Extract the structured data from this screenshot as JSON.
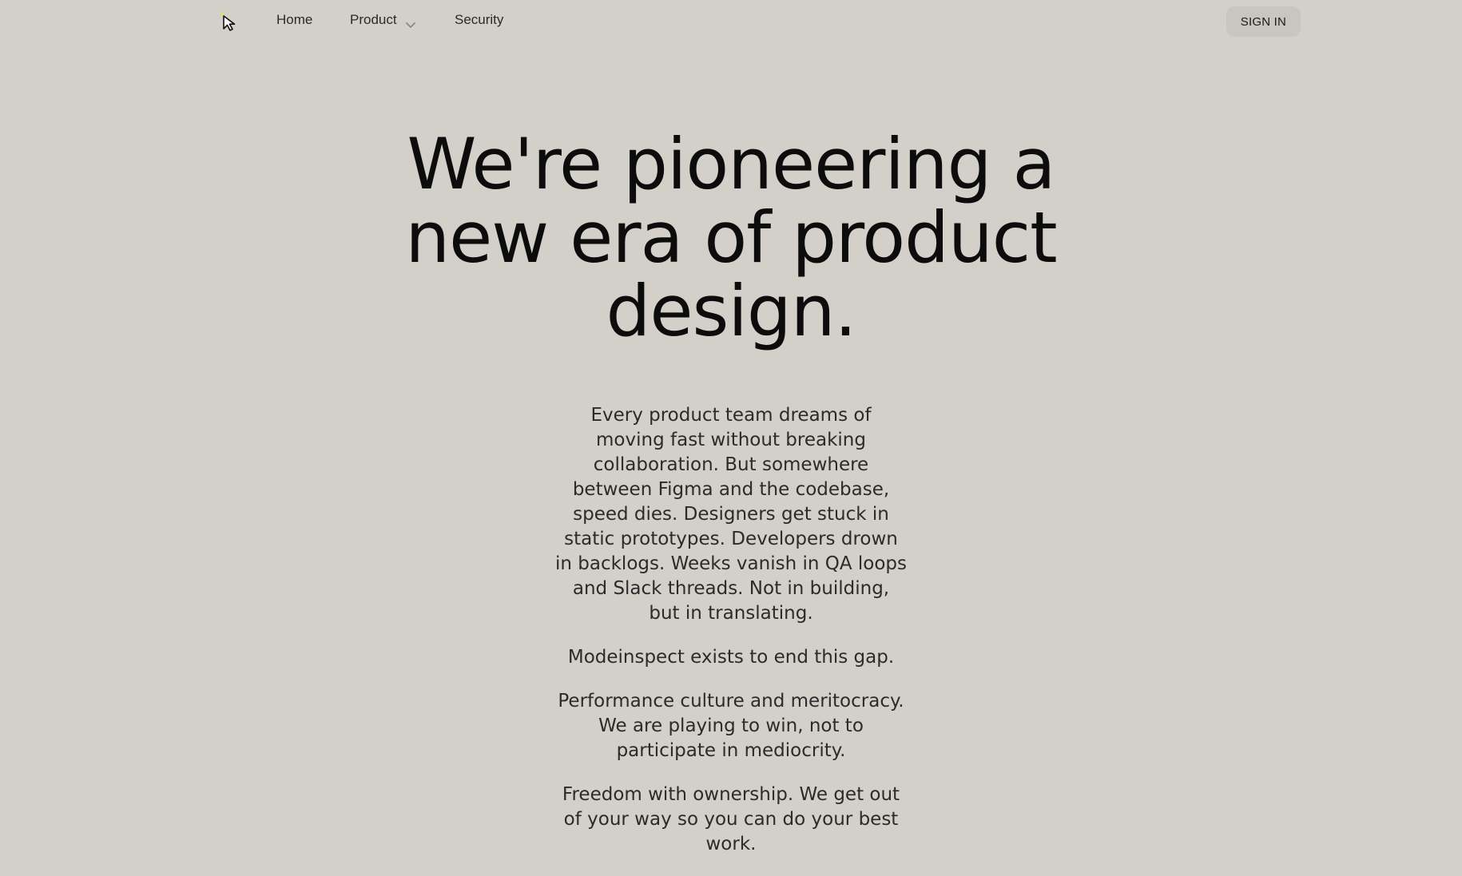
{
  "nav": {
    "logo_icon": "cursor-arrow-icon",
    "links": [
      {
        "label": "Home"
      },
      {
        "label": "Product",
        "icon": "chevron-down-icon"
      },
      {
        "label": "Security"
      }
    ],
    "signin_label": "SIGN IN"
  },
  "hero": {
    "headline": "We're pioneering a new era of product design."
  },
  "paragraphs": [
    "Every product team dreams of moving fast without breaking collaboration. But somewhere between Figma and the codebase, speed dies. Designers get stuck in static prototypes. Developers drown in backlogs. Weeks vanish in QA loops and Slack threads. Not in building, but in translating.",
    "Modeinspect exists to end this gap.",
    "Performance culture and meritocracy. We are playing to win, not to participate in mediocrity.",
    "Freedom with ownership. We get out of your way so you can do your best work."
  ],
  "colors": {
    "background": "#d2d0c8",
    "text": "#111111",
    "button_bg": "#c8c6bf"
  }
}
